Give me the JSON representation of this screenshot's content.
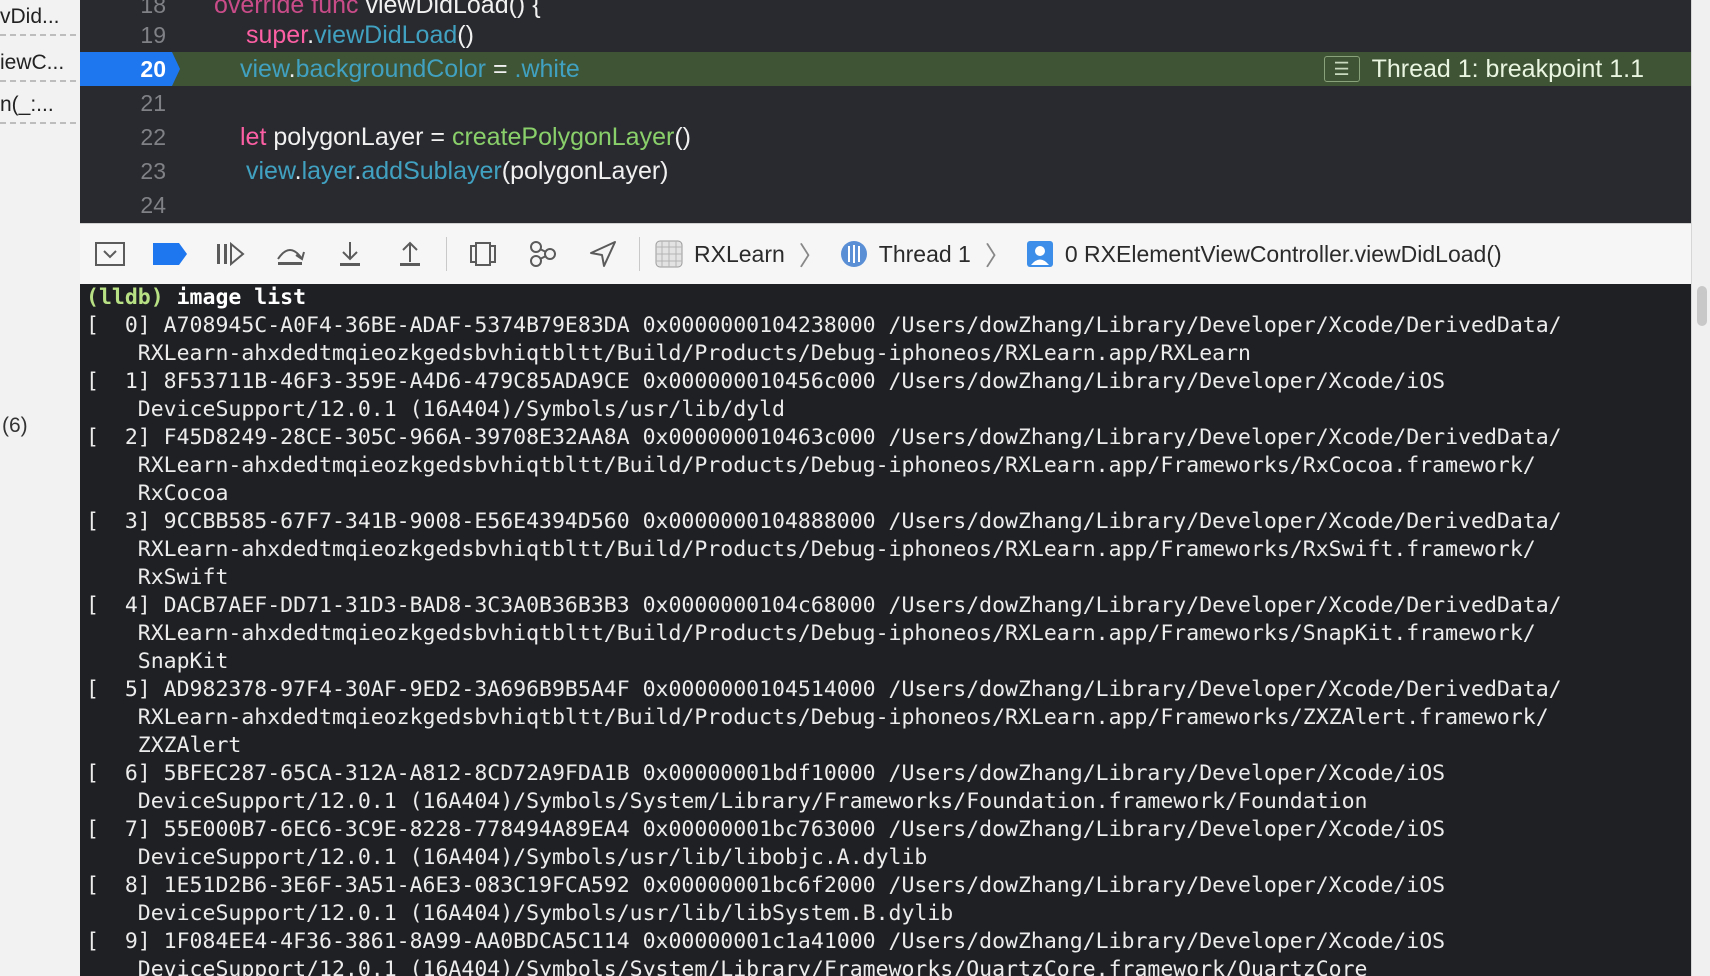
{
  "navigator": {
    "items": [
      "vDid...",
      "iewC...",
      "n(_:..."
    ],
    "count": "(6)"
  },
  "editor": {
    "lines": [
      {
        "num": "18",
        "code": "override func viewDidLoad() {"
      },
      {
        "num": "19",
        "code": "super.viewDidLoad()"
      },
      {
        "num": "20",
        "code": "view.backgroundColor = .white"
      },
      {
        "num": "21",
        "code": ""
      },
      {
        "num": "22",
        "code": "let polygonLayer = createPolygonLayer()"
      },
      {
        "num": "23",
        "code": "view.layer.addSublayer(polygonLayer)"
      },
      {
        "num": "24",
        "code": ""
      }
    ],
    "tokens": {
      "l18_kw": "override func ",
      "l18_fn": "viewDidLoad() {",
      "l19_kw": "super",
      "l19_dot": ".",
      "l19_fn": "viewDidLoad",
      "l19_par": "()",
      "l20_a": "view",
      "l20_b": ".",
      "l20_c": "backgroundColor",
      "l20_d": " = ",
      "l20_e": ".white",
      "l22_kw": "let",
      "l22_a": " polygonLayer = ",
      "l22_fn": "createPolygonLayer",
      "l22_par": "()",
      "l23_a": "view",
      "l23_b": ".",
      "l23_c": "layer",
      "l23_d": ".",
      "l23_e": "addSublayer",
      "l23_f": "(polygonLayer)"
    },
    "breakpoint_label": "Thread 1: breakpoint 1.1",
    "breakpoint_icon": "list-icon"
  },
  "debugbar": {
    "crumbs": [
      "RXLearn",
      "Thread 1",
      "0 RXElementViewController.viewDidLoad()"
    ]
  },
  "console": {
    "prompt": "(lldb)",
    "command": " image list",
    "lines": [
      "[  0] A708945C-A0F4-36BE-ADAF-5374B79E83DA 0x0000000104238000 /Users/dowZhang/Library/Developer/Xcode/DerivedData/",
      "    RXLearn-ahxdedtmqieozkgedsbvhiqtbltt/Build/Products/Debug-iphoneos/RXLearn.app/RXLearn",
      "[  1] 8F53711B-46F3-359E-A4D6-479C85ADA9CE 0x000000010456c000 /Users/dowZhang/Library/Developer/Xcode/iOS",
      "    DeviceSupport/12.0.1 (16A404)/Symbols/usr/lib/dyld",
      "[  2] F45D8249-28CE-305C-966A-39708E32AA8A 0x000000010463c000 /Users/dowZhang/Library/Developer/Xcode/DerivedData/",
      "    RXLearn-ahxdedtmqieozkgedsbvhiqtbltt/Build/Products/Debug-iphoneos/RXLearn.app/Frameworks/RxCocoa.framework/",
      "    RxCocoa",
      "[  3] 9CCBB585-67F7-341B-9008-E56E4394D560 0x0000000104888000 /Users/dowZhang/Library/Developer/Xcode/DerivedData/",
      "    RXLearn-ahxdedtmqieozkgedsbvhiqtbltt/Build/Products/Debug-iphoneos/RXLearn.app/Frameworks/RxSwift.framework/",
      "    RxSwift",
      "[  4] DACB7AEF-DD71-31D3-BAD8-3C3A0B36B3B3 0x0000000104c68000 /Users/dowZhang/Library/Developer/Xcode/DerivedData/",
      "    RXLearn-ahxdedtmqieozkgedsbvhiqtbltt/Build/Products/Debug-iphoneos/RXLearn.app/Frameworks/SnapKit.framework/",
      "    SnapKit",
      "[  5] AD982378-97F4-30AF-9ED2-3A696B9B5A4F 0x0000000104514000 /Users/dowZhang/Library/Developer/Xcode/DerivedData/",
      "    RXLearn-ahxdedtmqieozkgedsbvhiqtbltt/Build/Products/Debug-iphoneos/RXLearn.app/Frameworks/ZXZAlert.framework/",
      "    ZXZAlert",
      "[  6] 5BFEC287-65CA-312A-A812-8CD72A9FDA1B 0x00000001bdf10000 /Users/dowZhang/Library/Developer/Xcode/iOS",
      "    DeviceSupport/12.0.1 (16A404)/Symbols/System/Library/Frameworks/Foundation.framework/Foundation",
      "[  7] 55E000B7-6EC6-3C9E-8228-778494A89EA4 0x00000001bc763000 /Users/dowZhang/Library/Developer/Xcode/iOS",
      "    DeviceSupport/12.0.1 (16A404)/Symbols/usr/lib/libobjc.A.dylib",
      "[  8] 1E51D2B6-3E6F-3A51-A6E3-083C19FCA592 0x00000001bc6f2000 /Users/dowZhang/Library/Developer/Xcode/iOS",
      "    DeviceSupport/12.0.1 (16A404)/Symbols/usr/lib/libSystem.B.dylib",
      "[  9] 1F084EE4-4F36-3861-8A99-AA0BDCA5C114 0x00000001c1a41000 /Users/dowZhang/Library/Developer/Xcode/iOS",
      "    DeviceSupport/12.0.1 (16A404)/Symbols/System/Library/Frameworks/QuartzCore.framework/QuartzCore"
    ]
  },
  "colors": {
    "editor_bg": "#292a30",
    "breakpoint_blue": "#1e77ef",
    "current_line": "#3f5335",
    "keyword": "#fc5fa3",
    "property": "#41a1c0",
    "console_bg": "#1f2024"
  }
}
